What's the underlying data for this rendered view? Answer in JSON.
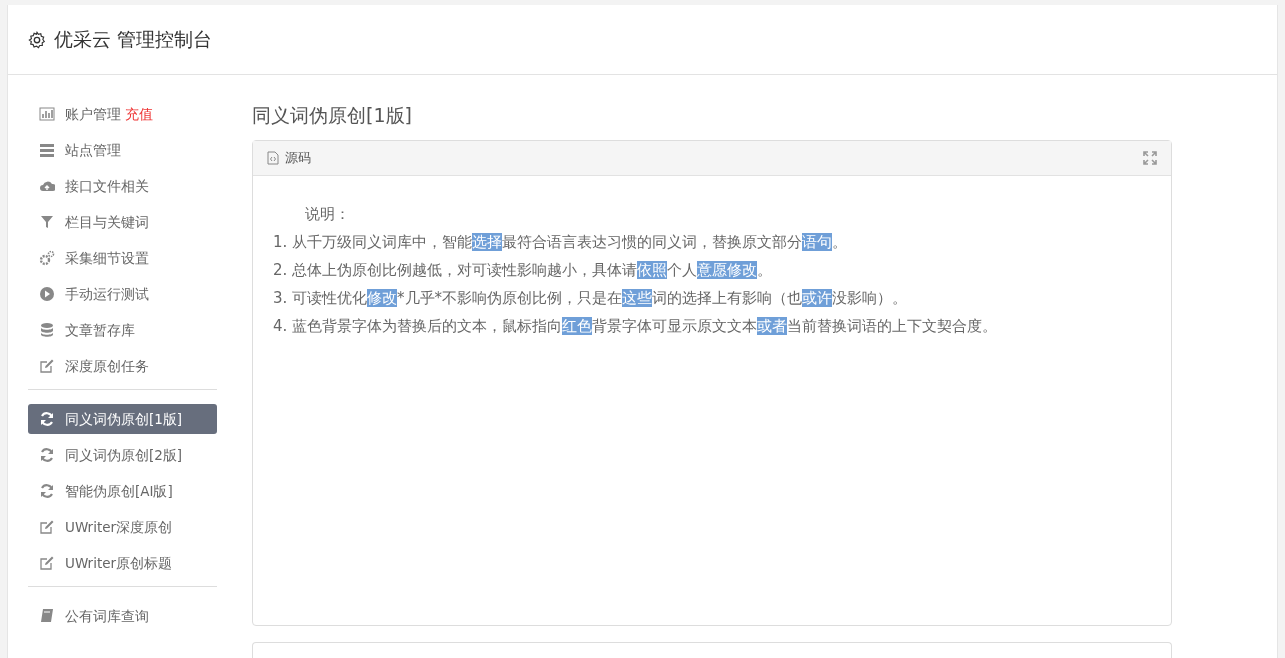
{
  "header": {
    "title": "优采云 管理控制台"
  },
  "sidebar": {
    "groups": [
      {
        "items": [
          {
            "kind": "chart",
            "label": "账户管理",
            "extra": "充值",
            "selected": false
          },
          {
            "kind": "server",
            "label": "站点管理",
            "selected": false
          },
          {
            "kind": "cloud",
            "label": "接口文件相关",
            "selected": false
          },
          {
            "kind": "filter",
            "label": "栏目与关键词",
            "selected": false
          },
          {
            "kind": "gears",
            "label": "采集细节设置",
            "selected": false
          },
          {
            "kind": "play",
            "label": "手动运行测试",
            "selected": false
          },
          {
            "kind": "database",
            "label": "文章暂存库",
            "selected": false
          },
          {
            "kind": "edit",
            "label": "深度原创任务",
            "selected": false
          }
        ]
      },
      {
        "items": [
          {
            "kind": "refresh",
            "label": "同义词伪原创[1版]",
            "selected": true
          },
          {
            "kind": "refresh",
            "label": "同义词伪原创[2版]",
            "selected": false
          },
          {
            "kind": "refresh",
            "label": "智能伪原创[AI版]",
            "selected": false
          },
          {
            "kind": "edit",
            "label": "UWriter深度原创",
            "selected": false
          },
          {
            "kind": "edit",
            "label": "UWriter原创标题",
            "selected": false
          }
        ]
      },
      {
        "items": [
          {
            "kind": "book",
            "label": "公有词库查询",
            "selected": false
          }
        ]
      }
    ]
  },
  "page": {
    "title": "同义词伪原创[1版]",
    "panel": {
      "tab": "源码",
      "intro": "说明：",
      "lines": [
        [
          {
            "text": "1. 从千万级同义词库中，智能",
            "highlight": false
          },
          {
            "text": "选择",
            "highlight": true
          },
          {
            "text": "最符合语言表达习惯的同义词，替换原文部分",
            "highlight": false
          },
          {
            "text": "语句",
            "highlight": true
          },
          {
            "text": "。",
            "highlight": false
          }
        ],
        [
          {
            "text": "2. 总体上伪原创比例越低，对可读性影响越小，具体请",
            "highlight": false
          },
          {
            "text": "依照",
            "highlight": true
          },
          {
            "text": "个人",
            "highlight": false
          },
          {
            "text": "意愿",
            "highlight": true
          },
          {
            "text": "修改",
            "highlight": true
          },
          {
            "text": "。",
            "highlight": false
          }
        ],
        [
          {
            "text": "3. 可读性优化",
            "highlight": false
          },
          {
            "text": "修改",
            "highlight": true
          },
          {
            "text": "*几乎*不影响伪原创比例，只是在",
            "highlight": false
          },
          {
            "text": "这些",
            "highlight": true
          },
          {
            "text": "词的选择上有影响（也",
            "highlight": false
          },
          {
            "text": "或许",
            "highlight": true
          },
          {
            "text": "没影响）。",
            "highlight": false
          }
        ],
        [
          {
            "text": "4. 蓝色背景字体为替换后的文本，鼠标指向",
            "highlight": false
          },
          {
            "text": "红色",
            "highlight": true
          },
          {
            "text": "背景字体可显示原文文本",
            "highlight": false
          },
          {
            "text": "或者",
            "highlight": true
          },
          {
            "text": "当前替换词语的上下文契合度。",
            "highlight": false
          }
        ]
      ]
    }
  }
}
